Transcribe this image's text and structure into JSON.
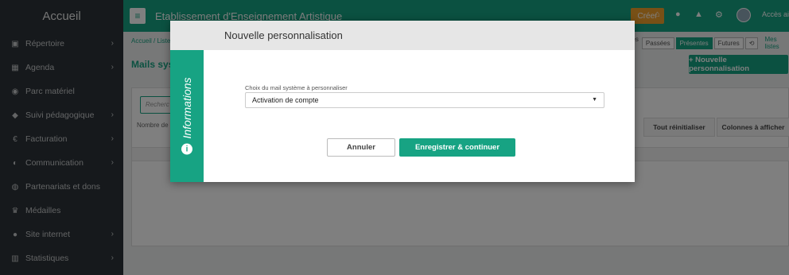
{
  "sidebar": {
    "title": "Accueil",
    "items": [
      {
        "label": "Répertoire",
        "icon": "address-book-icon",
        "glyph": "▣",
        "chevron": true
      },
      {
        "label": "Agenda",
        "icon": "calendar-icon",
        "glyph": "▦",
        "chevron": true
      },
      {
        "label": "Parc matériel",
        "icon": "guitar-icon",
        "glyph": "◉",
        "chevron": false
      },
      {
        "label": "Suivi pédagogique",
        "icon": "graduation-cap-icon",
        "glyph": "◆",
        "chevron": true
      },
      {
        "label": "Facturation",
        "icon": "euro-icon",
        "glyph": "€",
        "chevron": true
      },
      {
        "label": "Communication",
        "icon": "comments-icon",
        "glyph": "◐",
        "chevron": true
      },
      {
        "label": "Partenariats et dons",
        "icon": "handshake-icon",
        "glyph": "◍",
        "chevron": false
      },
      {
        "label": "Médailles",
        "icon": "trophy-icon",
        "glyph": "♛",
        "chevron": false
      },
      {
        "label": "Site internet",
        "icon": "globe-icon",
        "glyph": "●",
        "chevron": true
      },
      {
        "label": "Statistiques",
        "icon": "bar-chart-icon",
        "glyph": "▥",
        "chevron": true
      }
    ]
  },
  "topbar": {
    "menu_glyph": "≡",
    "org_name": "Etablissement d'Enseignement Artistique",
    "create_label": "Créer",
    "icons": [
      {
        "name": "home-icon",
        "glyph": "⌂"
      },
      {
        "name": "globe-icon",
        "glyph": "●"
      },
      {
        "name": "bell-icon",
        "glyph": "▲"
      },
      {
        "name": "cogs-icon",
        "glyph": "⚙"
      }
    ],
    "access_label": "Accès aid"
  },
  "content": {
    "breadcrumb": "Accueil / Liste",
    "page_title": "Mails syst",
    "view_filters": {
      "prefix": "ées :",
      "past": "Passées",
      "present": "Présentes",
      "future": "Futures",
      "history_glyph": "⟲",
      "my_lists": "Mes listes"
    },
    "new_button": "+ Nouvelle personnalisation",
    "search_placeholder": "Recherc",
    "count_label": "Nombre de r",
    "reset_button": "Tout réinitialiser",
    "columns_button": "Colonnes à afficher"
  },
  "modal": {
    "title": "Nouvelle personnalisation",
    "side_label": "Informations",
    "info_glyph": "i",
    "field_label": "Choix du mail système à personnaliser",
    "selected_value": "Activation de compte",
    "caret_glyph": "▼",
    "cancel_label": "Annuler",
    "save_label": "Enregistrer & continuer"
  },
  "colors": {
    "brand": "#17a383",
    "create": "#f0a12d",
    "sidebar_bg": "#2c3338"
  }
}
